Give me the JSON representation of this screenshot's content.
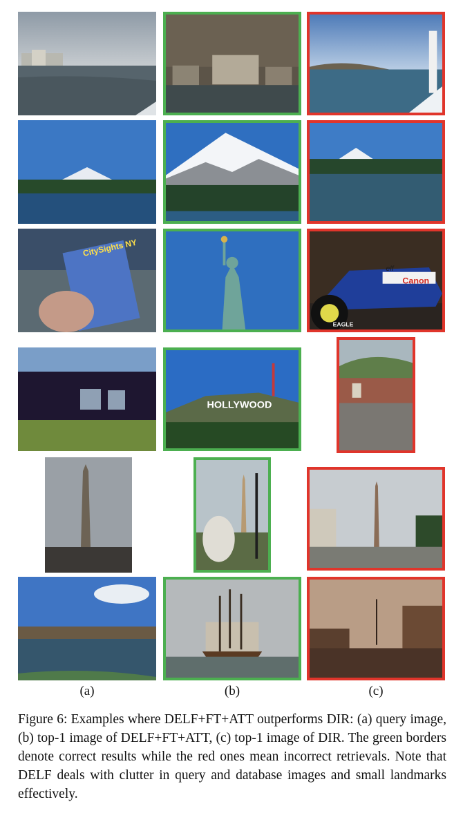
{
  "figure": {
    "column_labels": [
      "(a)",
      "(b)",
      "(c)"
    ],
    "caption": "Figure 6: Examples where DELF+FT+ATT outperforms DIR: (a) query image, (b) top-1 image of DELF+FT+ATT, (c) top-1 image of DIR. The green borders denote correct results while the red ones mean incorrect retrievals.  Note that DELF deals with clutter in query and database images and small landmarks effectively.",
    "image_text": {
      "hollywood_sign": "HOLLYWOOD",
      "guide_cover": "CitySights NY",
      "car_sponsor": "Canon",
      "car_sponsor2": "elf",
      "tyre": "EAGLE"
    },
    "colors": {
      "correct_border": "#4caf50",
      "incorrect_border": "#e0352b"
    }
  }
}
